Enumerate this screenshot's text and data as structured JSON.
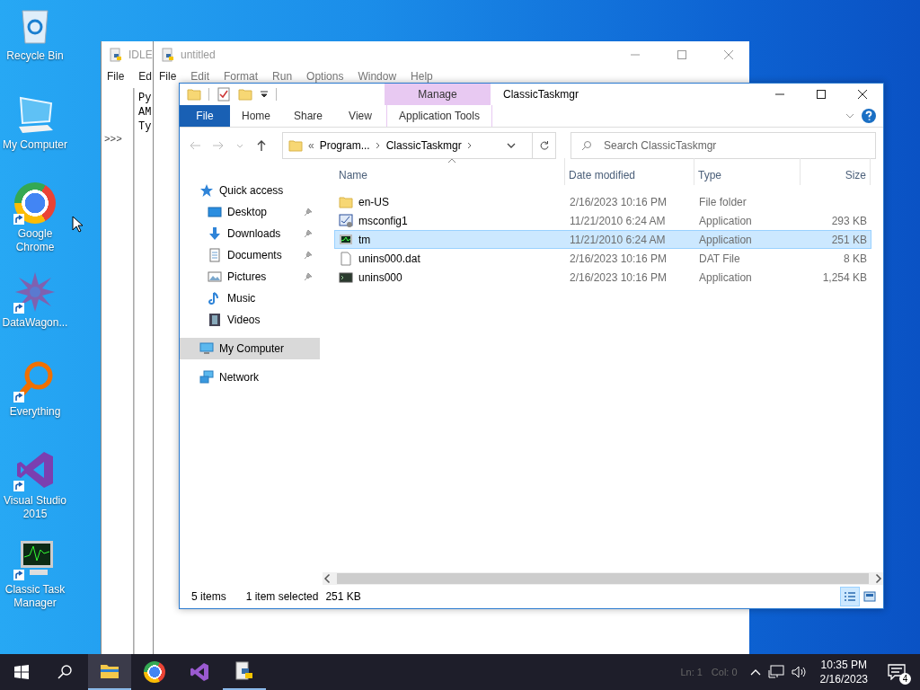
{
  "desktop": {
    "icons": [
      {
        "label": "Recycle Bin",
        "kind": "recycle-bin",
        "shortcut": false
      },
      {
        "label": "My Computer",
        "kind": "computer",
        "shortcut": false
      },
      {
        "label": "Google Chrome",
        "kind": "chrome",
        "shortcut": true
      },
      {
        "label": "DataWagon...",
        "kind": "datawagon",
        "shortcut": true
      },
      {
        "label": "Everything",
        "kind": "everything",
        "shortcut": true
      },
      {
        "label": "Visual Studio 2015",
        "kind": "visual-studio",
        "shortcut": true
      },
      {
        "label": "Classic Task Manager",
        "kind": "task-manager",
        "shortcut": true
      }
    ]
  },
  "idle_shell": {
    "title": "IDLE",
    "menu": [
      "File",
      "Ed"
    ],
    "prompt": ">>>",
    "lines": [
      "Py",
      "AM",
      "Ty"
    ]
  },
  "editor": {
    "title": "untitled",
    "menu": [
      "File",
      "Edit",
      "Format",
      "Run",
      "Options",
      "Window",
      "Help"
    ],
    "status": [
      "Ln: 1",
      "Col: 0"
    ]
  },
  "explorer": {
    "title": "ClassicTaskmgr",
    "context_header": "Manage",
    "tabs": [
      {
        "label": "File",
        "kind": "file"
      },
      {
        "label": "Home",
        "kind": "normal"
      },
      {
        "label": "Share",
        "kind": "normal"
      },
      {
        "label": "View",
        "kind": "normal"
      },
      {
        "label": "Application Tools",
        "kind": "context"
      }
    ],
    "address": {
      "overflow": "«",
      "segments": [
        "Program...",
        "ClassicTaskmgr"
      ]
    },
    "search": {
      "placeholder": "Search ClassicTaskmgr"
    },
    "nav": [
      {
        "label": "Quick access",
        "kind": "star",
        "selected": false,
        "children": [
          {
            "label": "Desktop",
            "kind": "desktop",
            "pinned": true,
            "selected": false
          },
          {
            "label": "Downloads",
            "kind": "downloads",
            "pinned": true,
            "selected": false
          },
          {
            "label": "Documents",
            "kind": "documents",
            "pinned": true,
            "selected": false
          },
          {
            "label": "Pictures",
            "kind": "pictures",
            "pinned": true,
            "selected": false
          },
          {
            "label": "Music",
            "kind": "music",
            "pinned": false,
            "selected": false
          },
          {
            "label": "Videos",
            "kind": "videos",
            "pinned": false,
            "selected": false
          }
        ]
      },
      {
        "label": "My Computer",
        "kind": "computer",
        "selected": true
      },
      {
        "label": "Network",
        "kind": "network",
        "selected": false
      }
    ],
    "columns": [
      {
        "label": "Name",
        "sorted": true
      },
      {
        "label": "Date modified",
        "sorted": false
      },
      {
        "label": "Type",
        "sorted": false
      },
      {
        "label": "Size",
        "sorted": false
      }
    ],
    "files": [
      {
        "name": "en-US",
        "date": "2/16/2023 10:16 PM",
        "type": "File folder",
        "kind": "folder",
        "selected": false
      },
      {
        "name": "msconfig1",
        "date": "11/21/2010 6:24 AM",
        "type": "Application",
        "size": "293 KB",
        "kind": "app-config",
        "selected": false
      },
      {
        "name": "tm",
        "date": "11/21/2010 6:24 AM",
        "type": "Application",
        "size": "251 KB",
        "kind": "app-monitor",
        "selected": true
      },
      {
        "name": "unins000.dat",
        "date": "2/16/2023 10:16 PM",
        "type": "DAT File",
        "size": "8 KB",
        "kind": "file",
        "selected": false
      },
      {
        "name": "unins000",
        "date": "2/16/2023 10:16 PM",
        "type": "Application",
        "size": "1,254 KB",
        "kind": "app-console",
        "selected": false
      }
    ],
    "status": [
      "5 items",
      "1 item selected",
      "251 KB"
    ],
    "views": [
      {
        "kind": "details",
        "selected": true
      },
      {
        "kind": "large-icons",
        "selected": false
      }
    ]
  },
  "taskbar": {
    "apps": [
      {
        "kind": "explorer",
        "selected": true,
        "running": true
      },
      {
        "kind": "chrome",
        "selected": false,
        "running": false
      },
      {
        "kind": "visual-studio",
        "selected": false,
        "running": false
      },
      {
        "kind": "python",
        "selected": false,
        "running": true
      }
    ],
    "time": "10:35 PM",
    "date": "2/16/2023",
    "notifications": "4"
  }
}
